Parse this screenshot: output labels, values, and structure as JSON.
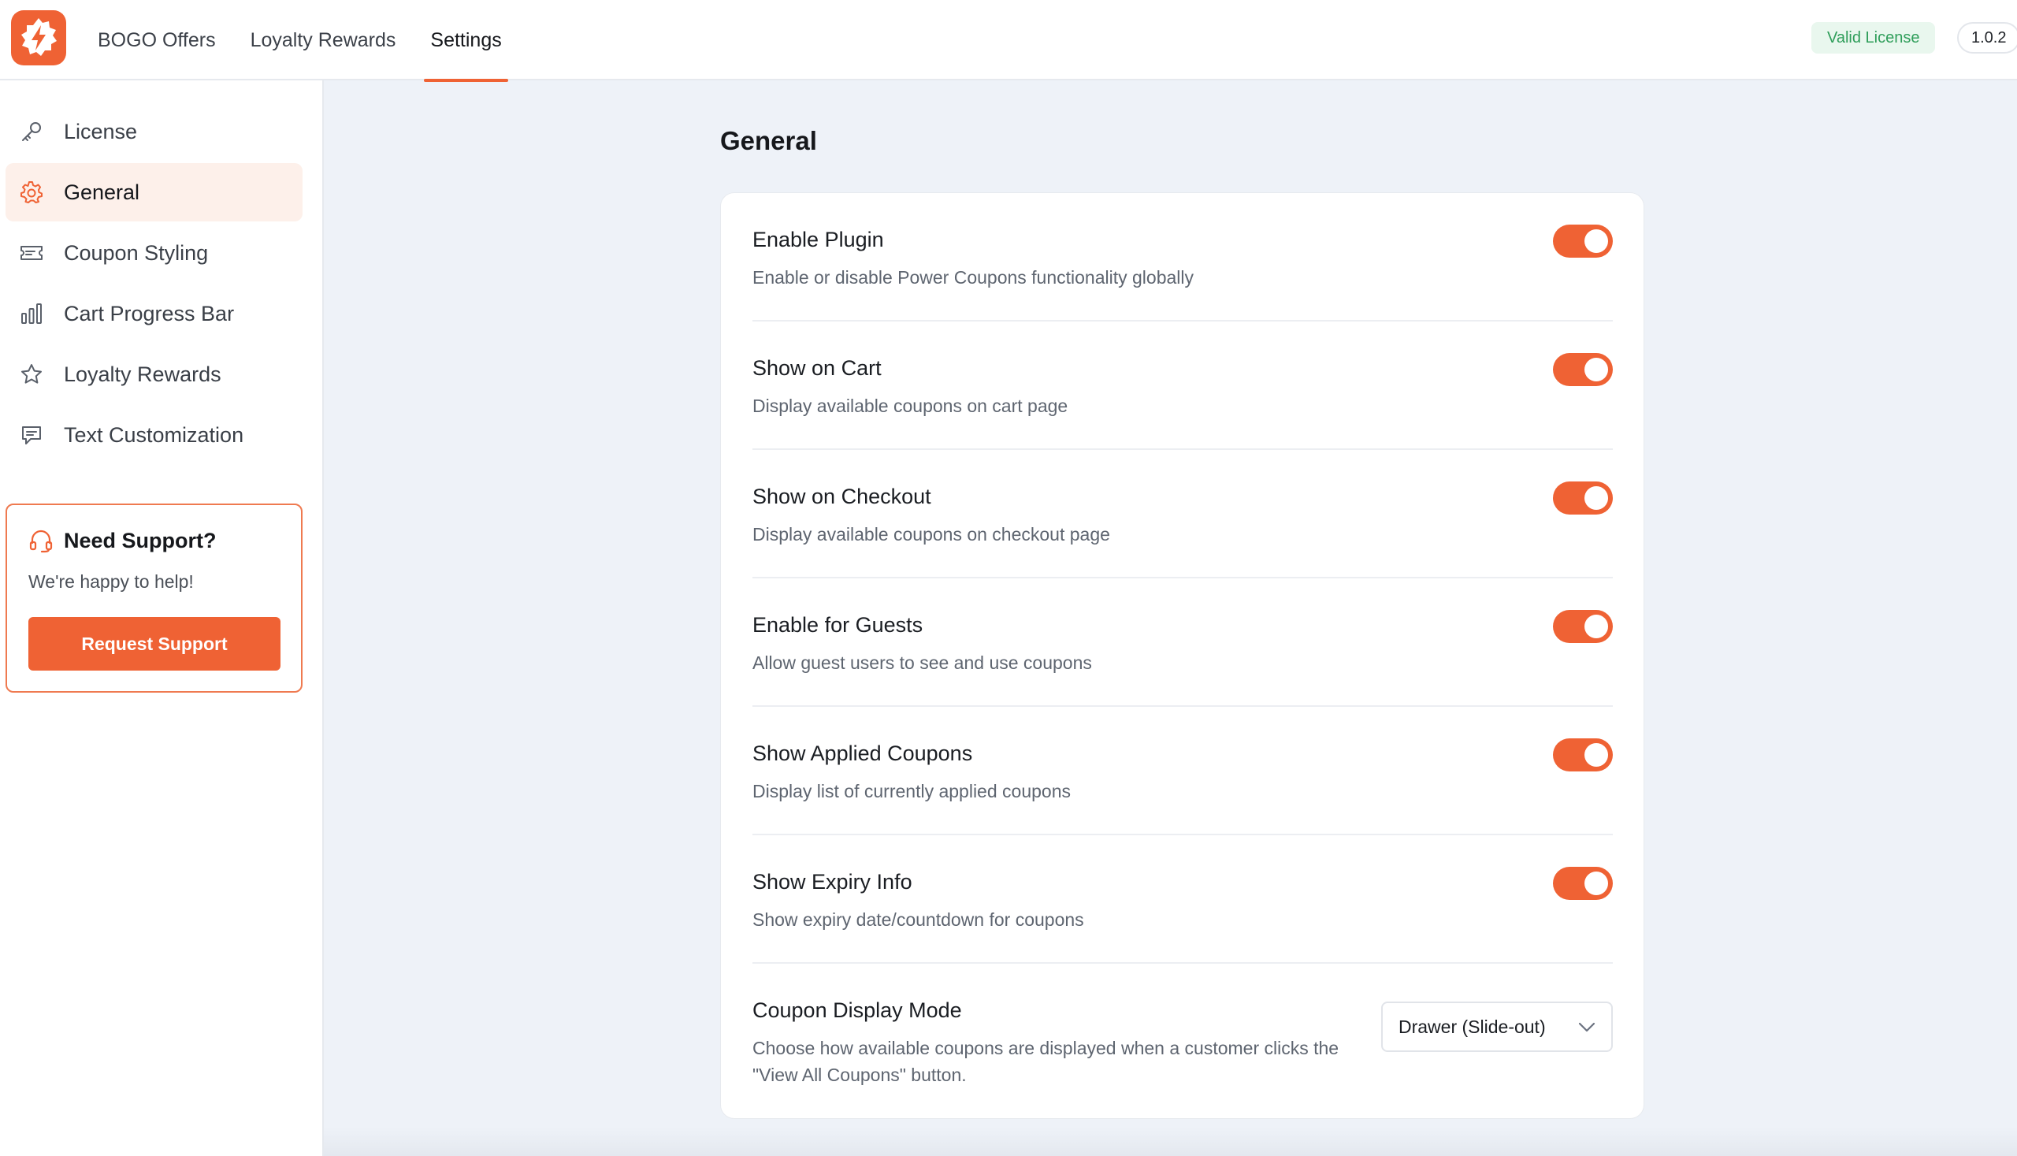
{
  "topbar": {
    "logo_icon": "lightning-badge-icon",
    "nav": [
      {
        "label": "BOGO Offers",
        "active": false
      },
      {
        "label": "Loyalty Rewards",
        "active": false
      },
      {
        "label": "Settings",
        "active": true
      }
    ],
    "license_badge": "Valid License",
    "version": "1.0.2"
  },
  "sidebar": {
    "items": [
      {
        "label": "License",
        "icon": "key-icon",
        "active": false
      },
      {
        "label": "General",
        "icon": "gear-icon",
        "active": true
      },
      {
        "label": "Coupon Styling",
        "icon": "ticket-icon",
        "active": false
      },
      {
        "label": "Cart Progress Bar",
        "icon": "bar-chart-icon",
        "active": false
      },
      {
        "label": "Loyalty Rewards",
        "icon": "star-icon",
        "active": false
      },
      {
        "label": "Text Customization",
        "icon": "message-icon",
        "active": false
      }
    ],
    "support": {
      "icon": "headset-icon",
      "title": "Need Support?",
      "subtitle": "We're happy to help!",
      "button": "Request Support"
    }
  },
  "main": {
    "title": "General",
    "settings": [
      {
        "title": "Enable Plugin",
        "description": "Enable or disable Power Coupons functionality globally",
        "enabled": true
      },
      {
        "title": "Show on Cart",
        "description": "Display available coupons on cart page",
        "enabled": true
      },
      {
        "title": "Show on Checkout",
        "description": "Display available coupons on checkout page",
        "enabled": true
      },
      {
        "title": "Enable for Guests",
        "description": "Allow guest users to see and use coupons",
        "enabled": true
      },
      {
        "title": "Show Applied Coupons",
        "description": "Display list of currently applied coupons",
        "enabled": true
      },
      {
        "title": "Show Expiry Info",
        "description": "Show expiry date/countdown for coupons",
        "enabled": true
      }
    ],
    "display_mode": {
      "title": "Coupon Display Mode",
      "description_line1": "Choose how available coupons are displayed when a customer clicks the",
      "description_line2": "\"View All Coupons\" button.",
      "selected": "Drawer (Slide-out)"
    }
  },
  "colors": {
    "accent": "#ef6234",
    "active_bg": "#fdf0ea",
    "license_green": "#2f9e5a",
    "page_bg": "#eef2f8"
  }
}
